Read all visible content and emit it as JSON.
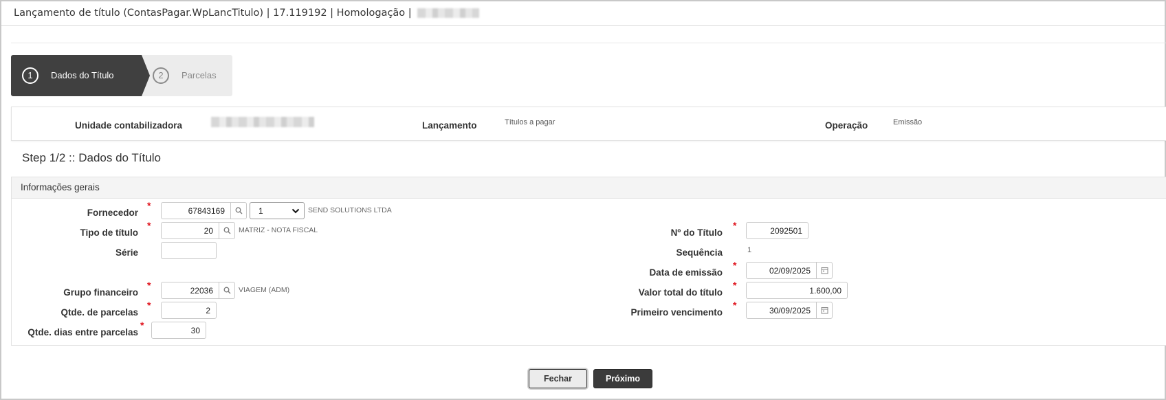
{
  "window": {
    "title": "Lançamento de título (ContasPagar.WpLancTitulo) | 17.119192 | Homologação |"
  },
  "wizard": {
    "steps": [
      {
        "number": "1",
        "label": "Dados do Título",
        "active": true
      },
      {
        "number": "2",
        "label": "Parcelas",
        "active": false
      }
    ]
  },
  "info": {
    "unidade_label": "Unidade contabilizadora",
    "lancamento_label": "Lançamento",
    "lancamento_value": "Títulos a pagar",
    "operacao_label": "Operação",
    "operacao_value": "Emissão"
  },
  "step_title": "Step 1/2 :: Dados do Título",
  "panel": {
    "title": "Informações gerais"
  },
  "form": {
    "fornecedor": {
      "label": "Fornecedor",
      "value": "67843169",
      "select_value": "1",
      "description": "SEND SOLUTIONS LTDA"
    },
    "tipo_titulo": {
      "label": "Tipo de título",
      "value": "20",
      "description": "MATRIZ - NOTA FISCAL"
    },
    "serie": {
      "label": "Série",
      "value": ""
    },
    "grupo_financeiro": {
      "label": "Grupo financeiro",
      "value": "22036",
      "description": "VIAGEM (ADM)"
    },
    "qtde_parcelas": {
      "label": "Qtde. de parcelas",
      "value": "2"
    },
    "qtde_dias": {
      "label": "Qtde. dias entre parcelas",
      "value": "30"
    },
    "numero_titulo": {
      "label": "Nº do Título",
      "value": "2092501"
    },
    "sequencia": {
      "label": "Sequência",
      "value": "1"
    },
    "data_emissao": {
      "label": "Data de emissão",
      "value": "02/09/2025"
    },
    "valor_total": {
      "label": "Valor total do título",
      "value": "1.600,00"
    },
    "primeiro_vencimento": {
      "label": "Primeiro vencimento",
      "value": "30/09/2025"
    },
    "required_mark": "*"
  },
  "buttons": {
    "close_label": "Fechar",
    "next_label": "Próximo"
  },
  "icons": {
    "search": "search-icon",
    "calendar": "calendar-icon",
    "dropdown": "chevron-down-icon"
  }
}
